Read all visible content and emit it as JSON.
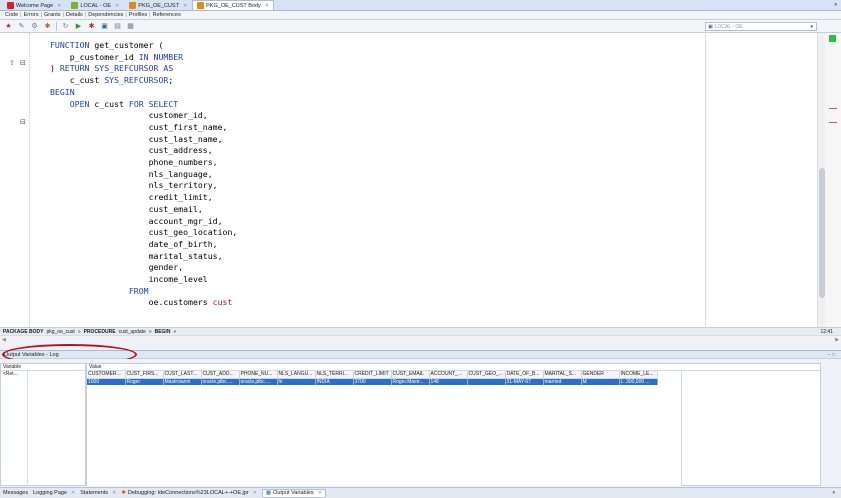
{
  "tabs": [
    {
      "label": "Welcome Page",
      "color": "#d4212a",
      "active": false
    },
    {
      "label": "LOCAL - OE",
      "color": "#7cae3a",
      "active": false
    },
    {
      "label": "PKG_OE_CUST",
      "color": "#e08a1e",
      "active": false
    },
    {
      "label": "PKG_OE_CUST Body",
      "color": "#e08a1e",
      "active": true
    }
  ],
  "subtabs": [
    "Code",
    "Errors",
    "Grants",
    "Details",
    "Dependencies",
    "Profiles",
    "References"
  ],
  "connection": "LOCAL - OE",
  "code_lines": [
    [
      {
        "t": "FUNCTION ",
        "c": "kw"
      },
      {
        "t": "get_customer ("
      }
    ],
    [
      {
        "t": "    p_customer_id "
      },
      {
        "t": "IN NUMBER",
        "c": "kw"
      }
    ],
    [
      {
        "t": ") "
      },
      {
        "t": "RETURN ",
        "c": "kw"
      },
      {
        "t": "SYS_REFCURSOR AS",
        "c": "kw"
      }
    ],
    [
      {
        "t": "    c_cust "
      },
      {
        "t": "SYS_REFCURSOR",
        "c": "kw"
      },
      {
        "t": ";"
      }
    ],
    [
      {
        "t": "BEGIN",
        "c": "kw"
      }
    ],
    [
      {
        "t": "    "
      },
      {
        "t": "OPEN ",
        "c": "kw"
      },
      {
        "t": "c_cust "
      },
      {
        "t": "FOR SELECT",
        "c": "kw"
      }
    ],
    [
      {
        "t": "                    customer_id,"
      }
    ],
    [
      {
        "t": "                    cust_first_name,"
      }
    ],
    [
      {
        "t": "                    cust_last_name,"
      }
    ],
    [
      {
        "t": "                    cust_address,"
      }
    ],
    [
      {
        "t": "                    phone_numbers,"
      }
    ],
    [
      {
        "t": "                    nls_language,"
      }
    ],
    [
      {
        "t": "                    nls_territory,"
      }
    ],
    [
      {
        "t": "                    credit_limit,"
      }
    ],
    [
      {
        "t": "                    cust_email,"
      }
    ],
    [
      {
        "t": "                    account_mgr_id,"
      }
    ],
    [
      {
        "t": "                    cust_geo_location,"
      }
    ],
    [
      {
        "t": "                    date_of_birth,"
      }
    ],
    [
      {
        "t": "                    marital_status,"
      }
    ],
    [
      {
        "t": "                    gender,"
      }
    ],
    [
      {
        "t": "                    income_level"
      }
    ],
    [
      {
        "t": "                "
      },
      {
        "t": "FROM",
        "c": "kw"
      }
    ],
    [
      {
        "t": "                    oe.customers "
      },
      {
        "t": "cust",
        "c": "ty"
      }
    ]
  ],
  "breadcrumb": {
    "package_kw": "PACKAGE BODY",
    "package": "pkg_oe_cust",
    "procedure_kw": "PROCEDURE",
    "procedure": "cust_update",
    "block": "BEGIN"
  },
  "caret_position": "12:41",
  "output": {
    "title": "Output Variables - Log",
    "variable_header": "Variable",
    "value_header": "Value",
    "variable_name": "<Ret...",
    "columns": [
      "CUSTOMER...",
      "CUST_FIRS...",
      "CUST_LAST...",
      "CUST_ADD...",
      "PHONE_NU...",
      "NLS_LANGU...",
      "NLS_TERRI...",
      "CREDIT_LIMIT",
      "CUST_EMAIL",
      "ACCOUNT_...",
      "CUST_GEO_...",
      "DATE_OF_B...",
      "MARITAL_S...",
      "GENDER",
      "INCOME_LE..."
    ],
    "row": [
      "1000",
      "Roger",
      "Mastroianni",
      "oracle.jdbc....",
      "oracle.jdbc....",
      "hi",
      "INDIA",
      "3700",
      "Roger.Mastr...",
      "148",
      "",
      "31-MAY-67",
      "married",
      "M",
      "L: 300,000 ..."
    ]
  },
  "bottom_tabs": [
    {
      "label": "Messages",
      "active": false
    },
    {
      "label": "Logging Page",
      "active": false
    },
    {
      "label": "Statements",
      "active": false
    },
    {
      "label": "Debugging: IdeConnections%23LOCAL+-+OE.jpr",
      "active": false
    },
    {
      "label": "Output Variables",
      "active": true
    }
  ]
}
